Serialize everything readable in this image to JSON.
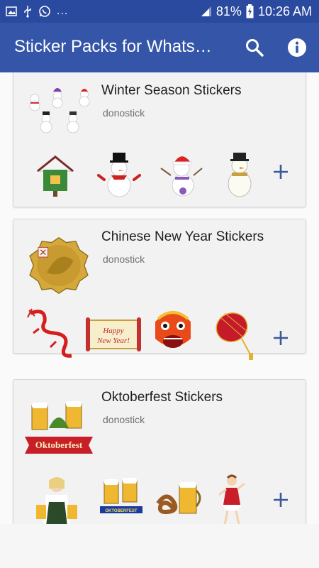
{
  "status_bar": {
    "battery": "81%",
    "time": "10:26 AM",
    "left_icons": [
      "image-icon",
      "usb-icon",
      "whatsapp-icon",
      "more-dots-icon"
    ],
    "right_icons": [
      "signal-icon",
      "battery-charging-icon"
    ]
  },
  "app_bar": {
    "title": "Sticker Packs for WhatsApp",
    "actions": [
      "search-icon",
      "info-icon"
    ]
  },
  "packs": [
    {
      "name": "Winter Season Stickers",
      "author": "donostick",
      "tray_icon": "snowmen-tray-icon",
      "stickers": [
        "snowy-birdhouse-sticker",
        "top-hat-snowman-sticker",
        "santa-hat-snowman-sticker",
        "scarf-snowman-sticker"
      ]
    },
    {
      "name": "Chinese New Year Stickers",
      "author": "donostick",
      "tray_icon": "gold-coin-tray-icon",
      "stickers": [
        "red-dragon-sticker",
        "happy-new-year-scroll-sticker",
        "lion-dance-sticker",
        "red-lantern-sticker"
      ]
    },
    {
      "name": "Oktoberfest Stickers",
      "author": "donostick",
      "tray_icon": "oktoberfest-banner-tray-icon",
      "tray_banner_text": "Oktoberfest",
      "stickers": [
        "dirndl-waitress-sticker",
        "beer-mugs-sticker",
        "pretzel-beer-sticker",
        "dancing-girl-sticker"
      ],
      "sticker_texts": {
        "scroll": "Happy New Year!",
        "banner": "OKTOBERFEST"
      }
    }
  ],
  "colors": {
    "status_bar": "#2a4aa0",
    "app_bar": "#3556a8",
    "add_icon": "#3b5998",
    "card_bg": "#f2f2f2"
  }
}
